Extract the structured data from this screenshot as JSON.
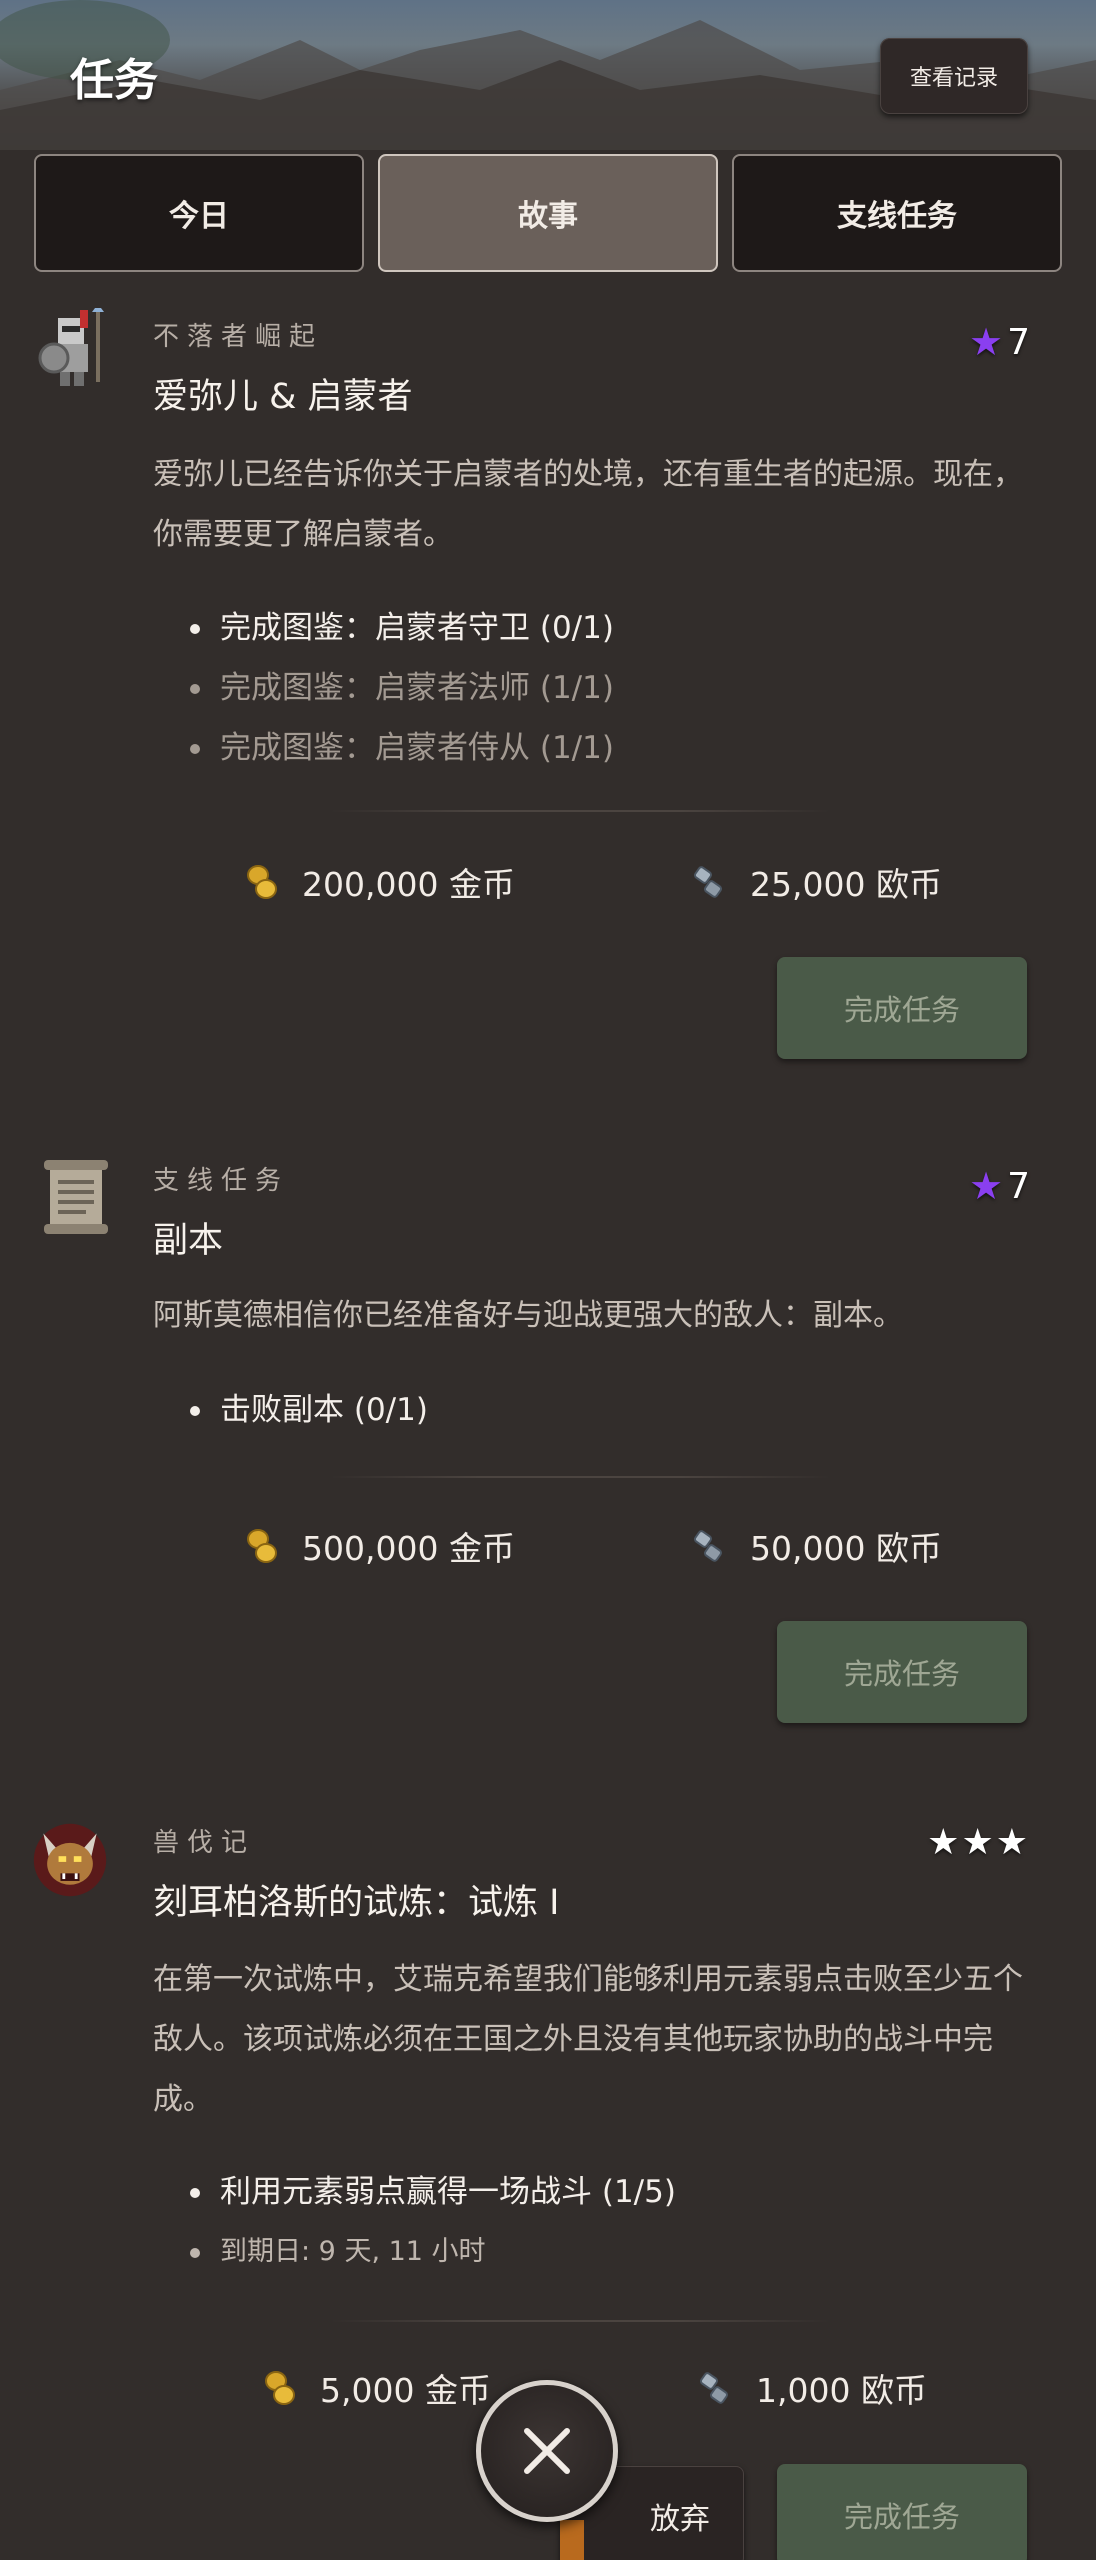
{
  "header": {
    "title": "任务",
    "history_button": "查看记录"
  },
  "tabs": [
    {
      "label": "今日",
      "active": false
    },
    {
      "label": "故事",
      "active": true
    },
    {
      "label": "支线任务",
      "active": false
    }
  ],
  "colors": {
    "complete_button": "#4a5a48",
    "active_tab": "#6a605a",
    "star_purple": "#8a3ff0"
  },
  "quests": [
    {
      "icon": "knight-icon",
      "category": "不落者崛起",
      "stars": "7",
      "title": "爱弥儿 & 启蒙者",
      "description": "爱弥儿已经告诉你关于启蒙者的处境，还有重生者的起源。现在，你需要更了解启蒙者。",
      "objectives": [
        "完成图鉴：启蒙者守卫 (0/1)",
        "完成图鉴：启蒙者法师 (1/1)",
        "完成图鉴：启蒙者侍从 (1/1)"
      ],
      "reward_gold": "200,000 金币",
      "reward_euro": "25,000 欧币",
      "complete_button": "完成任务"
    },
    {
      "icon": "scroll-icon",
      "category": "支线任务",
      "stars": "7",
      "title": "副本",
      "description": "阿斯莫德相信你已经准备好与迎战更强大的敌人：副本。",
      "objectives": [
        "击败副本 (0/1)"
      ],
      "reward_gold": "500,000 金币",
      "reward_euro": "50,000 欧币",
      "complete_button": "完成任务"
    },
    {
      "icon": "beast-icon",
      "category": "兽伐记",
      "stars": "★★★",
      "title": "刻耳柏洛斯的试炼：试炼 I",
      "description": "在第一次试炼中，艾瑞克希望我们能够利用元素弱点击败至少五个敌人。该项试炼必须在王国之外且没有其他玩家协助的战斗中完成。",
      "objectives": [
        "利用元素弱点赢得一场战斗 (1/5)",
        "到期日: 9 天, 11 小时"
      ],
      "reward_gold": "5,000 金币",
      "reward_euro": "1,000 欧币",
      "complete_button": "完成任务",
      "abandon_button": "放弃"
    }
  ]
}
